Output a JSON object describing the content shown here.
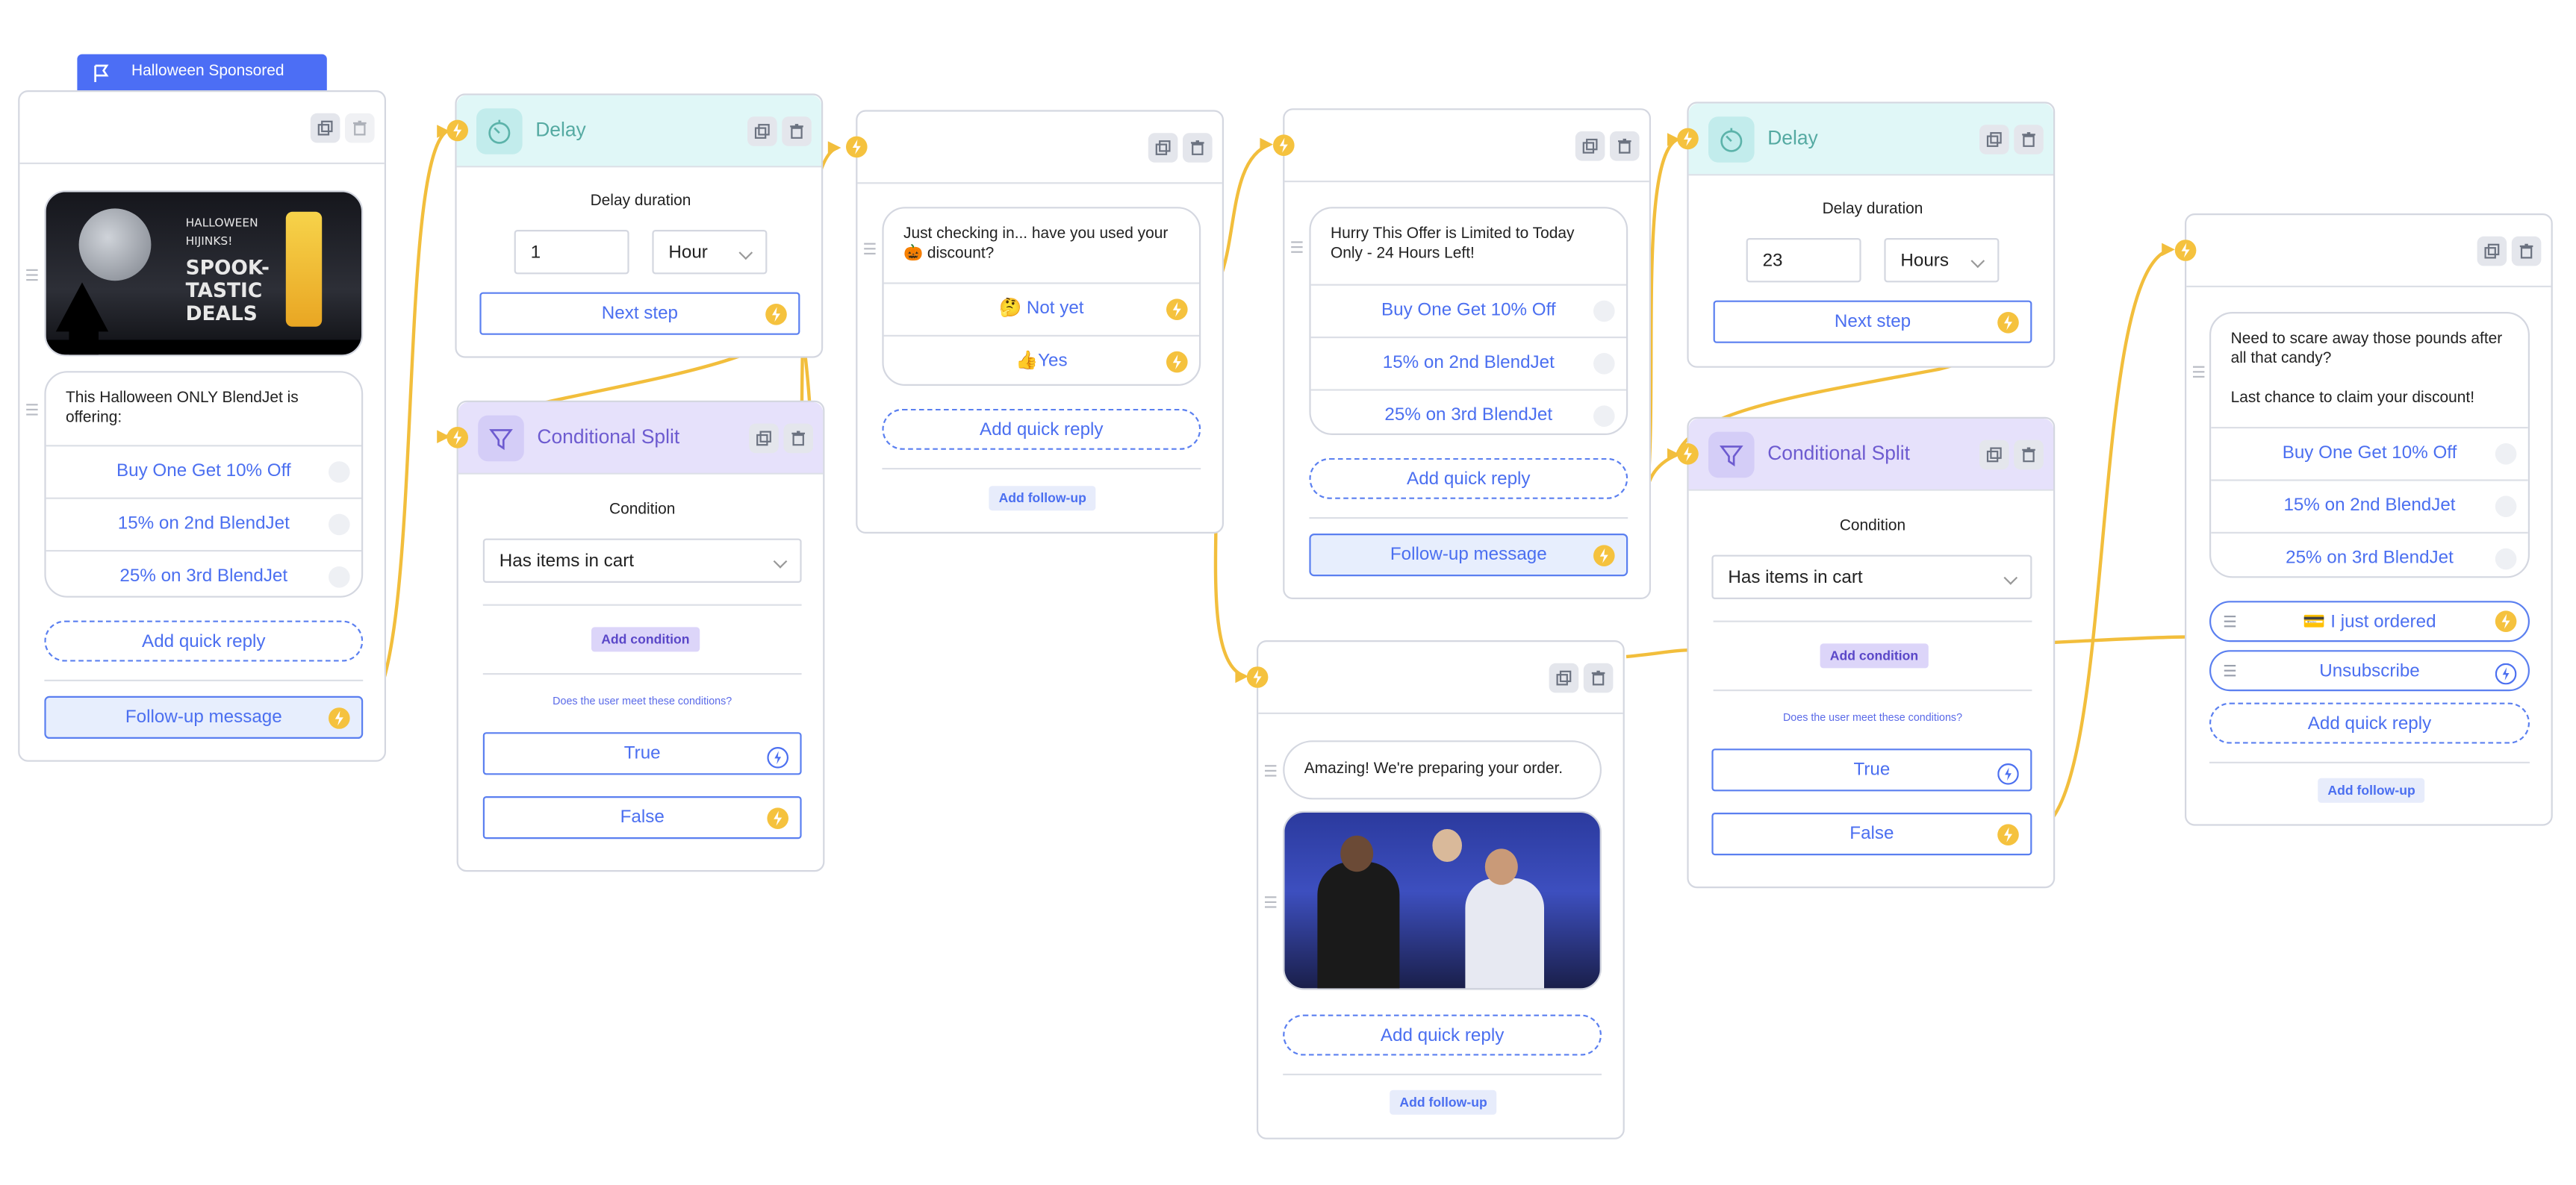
{
  "colors": {
    "accent": "#4b6ff0",
    "wire": "#f2be3c",
    "delay_bg": "#e0f7f7",
    "split_bg": "#e6e1fb"
  },
  "flag": {
    "label": "Halloween Sponsored",
    "icon": "flag-icon"
  },
  "msg1": {
    "image": {
      "lines": [
        "HALLOWEEN",
        "HIJINKS!",
        "SPOOK-",
        "TASTIC",
        "DEALS"
      ]
    },
    "text": "This Halloween ONLY BlendJet is offering:",
    "buttons": [
      "Buy One Get 10% Off",
      "15% on 2nd BlendJet",
      "25% on 3rd BlendJet"
    ],
    "add_quick_reply": "Add quick reply",
    "follow_up": "Follow-up message"
  },
  "delay1": {
    "title": "Delay",
    "duration_label": "Delay duration",
    "value": "1",
    "unit": "Hour",
    "next": "Next step"
  },
  "split1": {
    "title": "Conditional Split",
    "condition_label": "Condition",
    "condition": "Has items in cart",
    "add_condition": "Add condition",
    "question": "Does the user meet these conditions?",
    "true_label": "True",
    "false_label": "False"
  },
  "msg2": {
    "text": "Just checking in... have you used your 🎃 discount?",
    "buttons": [
      "🤔 Not yet",
      "👍Yes"
    ],
    "add_quick_reply": "Add quick reply",
    "add_follow_up": "Add follow-up"
  },
  "msg3": {
    "text": "Hurry This Offer is Limited to Today Only - 24 Hours Left!",
    "buttons": [
      "Buy One Get 10% Off",
      "15% on 2nd BlendJet",
      "25% on 3rd BlendJet"
    ],
    "add_quick_reply": "Add quick reply",
    "follow_up": "Follow-up message"
  },
  "msg4": {
    "text": "Amazing! We're preparing your order.",
    "add_quick_reply": "Add quick reply",
    "add_follow_up": "Add follow-up"
  },
  "delay2": {
    "title": "Delay",
    "duration_label": "Delay duration",
    "value": "23",
    "unit": "Hours",
    "next": "Next step"
  },
  "split2": {
    "title": "Conditional Split",
    "condition_label": "Condition",
    "condition": "Has items in cart",
    "add_condition": "Add condition",
    "question": "Does the user meet these conditions?",
    "true_label": "True",
    "false_label": "False"
  },
  "msg5": {
    "text": "Need to scare away those pounds after all that candy?\n\nLast chance to claim your discount!",
    "buttons": [
      "Buy One Get 10% Off",
      "15% on 2nd BlendJet",
      "25% on 3rd BlendJet"
    ],
    "quick_replies": [
      "💳 I just ordered",
      "Unsubscribe"
    ],
    "add_quick_reply": "Add quick reply",
    "add_follow_up": "Add follow-up"
  }
}
